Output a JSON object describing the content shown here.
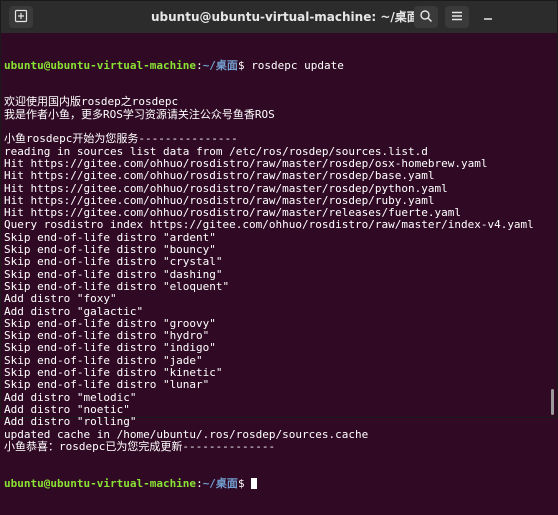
{
  "window": {
    "title": "ubuntu@ubuntu-virtual-machine: ~/桌面",
    "new_tab_icon": "new-tab-icon",
    "search_icon": "search-icon",
    "menu_icon": "hamburger-menu-icon",
    "minimize_icon": "minimize-icon"
  },
  "colors": {
    "background": "#300a24",
    "prompt_user": "#8ae234",
    "prompt_path": "#729fcf",
    "text": "#ffffff",
    "titlebar": "#2c2c2c"
  },
  "prompt": {
    "user": "ubuntu@ubuntu-virtual-machine",
    "sep": ":",
    "path": "~/桌面",
    "sign": "$ "
  },
  "first_command": "rosdepc update",
  "output": [
    "欢迎使用国内版rosdep之rosdepc",
    "我是作者小鱼，更多ROS学习资源请关注公众号鱼香ROS",
    "",
    "小鱼rosdepc开始为您服务---------------",
    "reading in sources list data from /etc/ros/rosdep/sources.list.d",
    "Hit https://gitee.com/ohhuo/rosdistro/raw/master/rosdep/osx-homebrew.yaml",
    "Hit https://gitee.com/ohhuo/rosdistro/raw/master/rosdep/base.yaml",
    "Hit https://gitee.com/ohhuo/rosdistro/raw/master/rosdep/python.yaml",
    "Hit https://gitee.com/ohhuo/rosdistro/raw/master/rosdep/ruby.yaml",
    "Hit https://gitee.com/ohhuo/rosdistro/raw/master/releases/fuerte.yaml",
    "Query rosdistro index https://gitee.com/ohhuo/rosdistro/raw/master/index-v4.yaml",
    "Skip end-of-life distro \"ardent\"",
    "Skip end-of-life distro \"bouncy\"",
    "Skip end-of-life distro \"crystal\"",
    "Skip end-of-life distro \"dashing\"",
    "Skip end-of-life distro \"eloquent\"",
    "Add distro \"foxy\"",
    "Add distro \"galactic\"",
    "Skip end-of-life distro \"groovy\"",
    "Skip end-of-life distro \"hydro\"",
    "Skip end-of-life distro \"indigo\"",
    "Skip end-of-life distro \"jade\"",
    "Skip end-of-life distro \"kinetic\"",
    "Skip end-of-life distro \"lunar\"",
    "Add distro \"melodic\"",
    "Add distro \"noetic\"",
    "Add distro \"rolling\"",
    "updated cache in /home/ubuntu/.ros/rosdep/sources.cache",
    "小鱼恭喜：rosdepc已为您完成更新--------------"
  ]
}
